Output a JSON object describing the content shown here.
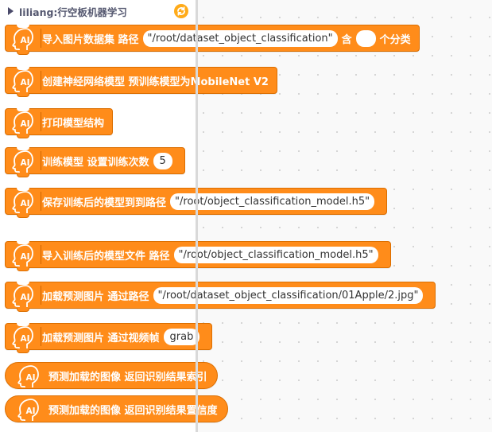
{
  "flyout": {
    "category_title": "liliang:行空板机器学习",
    "refresh_icon": "refresh-icon"
  },
  "colors": {
    "block_fill": "#ff8c1a",
    "block_border": "#db6e00",
    "refresh_icon": "#ffab19"
  },
  "blocks": [
    {
      "type": "command",
      "label": "导入图片数据集 路径",
      "input_value": "/root/dataset_object_classification",
      "label2": "含",
      "input2_value": "",
      "label3": "个分类"
    },
    {
      "type": "command",
      "label": "创建神经网络模型 预训练模型为MobileNet V2"
    },
    {
      "type": "command",
      "label": "打印模型结构"
    },
    {
      "type": "command",
      "label": "训练模型 设置训练次数",
      "input_value": "5"
    },
    {
      "type": "command",
      "label": "保存训练后的模型到到路径",
      "input_value": "/root/object_classification_model.h5"
    },
    {
      "type": "command",
      "label": "导入训练后的模型文件 路径",
      "input_value": "/root/object_classification_model.h5"
    },
    {
      "type": "command",
      "label": "加载预测图片 通过路径",
      "input_value": "/root/dataset_object_classification/01Apple/2.jpg"
    },
    {
      "type": "command",
      "label": "加载预测图片 通过视频帧",
      "input_value": "grab"
    },
    {
      "type": "reporter",
      "label": "预测加载的图像 返回识别结果索引"
    },
    {
      "type": "reporter",
      "label": "预测加载的图像 返回识别结果置信度"
    }
  ],
  "quote_open": "\"",
  "quote_close": "\""
}
